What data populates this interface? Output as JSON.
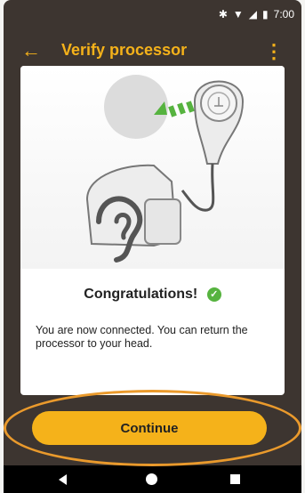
{
  "status_bar": {
    "time": "7:00",
    "icons": [
      "bluetooth-icon",
      "wifi-icon",
      "signal-icon",
      "battery-icon"
    ]
  },
  "app_bar": {
    "title": "Verify processor",
    "back_icon": "arrow-left-icon",
    "menu_icon": "more-vertical-icon"
  },
  "card": {
    "illustration": "processor-connection-illustration",
    "heading": "Congratulations!",
    "heading_icon": "check-circle-icon",
    "message": "You are now connected. You can return the processor to your head."
  },
  "actions": {
    "continue_label": "Continue"
  },
  "nav_bar": {
    "icons": [
      "back-triangle-icon",
      "home-circle-icon",
      "recent-square-icon"
    ]
  },
  "colors": {
    "accent": "#f5b21a",
    "background": "#3d3530",
    "success": "#56b33f",
    "highlight": "#ea9a2c"
  }
}
